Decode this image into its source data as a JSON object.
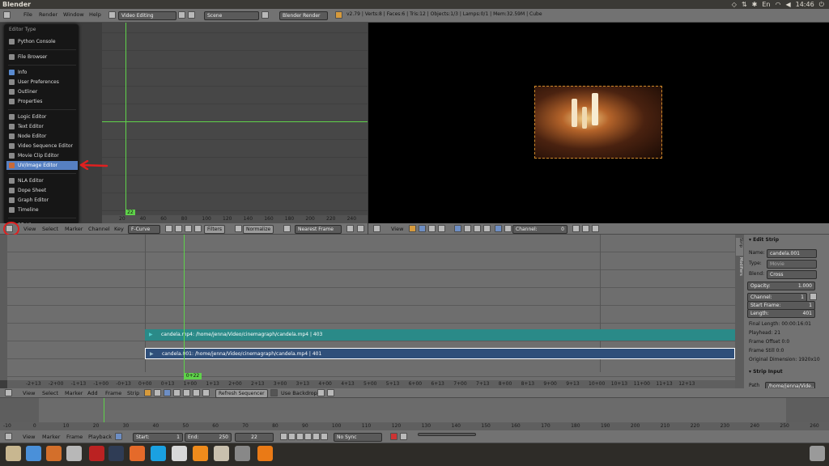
{
  "os": {
    "title": "Blender",
    "time": "14:46",
    "tray_icons": [
      "dropbox-icon",
      "transfer-icon",
      "bluetooth-icon",
      "keyboard-icon",
      "wifi-icon",
      "volume-icon",
      "power-icon"
    ]
  },
  "info_header": {
    "menus": [
      "File",
      "Render",
      "Window",
      "Help"
    ],
    "screen": "Video Editing",
    "scene": "Scene",
    "engine": "Blender Render",
    "stats": "v2.79 | Verts:8 | Faces:6 | Tris:12 | Objects:1/3 | Lamps:0/1 | Mem:32.59M | Cube"
  },
  "editor_menu": {
    "title": "Editor Type",
    "groups": [
      [
        {
          "label": "Python Console",
          "icon": "#8a8a8a"
        }
      ],
      [
        {
          "label": "File Browser",
          "icon": "#8a8a8a"
        }
      ],
      [
        {
          "label": "Info",
          "icon": "#5a8bd0"
        },
        {
          "label": "User Preferences",
          "icon": "#8a8a8a"
        },
        {
          "label": "Outliner",
          "icon": "#8a8a8a"
        },
        {
          "label": "Properties",
          "icon": "#8a8a8a"
        }
      ],
      [
        {
          "label": "Logic Editor",
          "icon": "#8a8a8a"
        },
        {
          "label": "Text Editor",
          "icon": "#8a8a8a"
        },
        {
          "label": "Node Editor",
          "icon": "#8a8a8a"
        },
        {
          "label": "Video Sequence Editor",
          "icon": "#8a8a8a"
        },
        {
          "label": "Movie Clip Editor",
          "icon": "#8a8a8a"
        },
        {
          "label": "UV/Image Editor",
          "icon": "#c96a3a",
          "selected": true
        }
      ],
      [
        {
          "label": "NLA Editor",
          "icon": "#8a8a8a"
        },
        {
          "label": "Dope Sheet",
          "icon": "#8a8a8a"
        },
        {
          "label": "Graph Editor",
          "icon": "#8a8a8a"
        },
        {
          "label": "Timeline",
          "icon": "#8a8a8a"
        }
      ],
      [
        {
          "label": "3D View",
          "icon": "#8a8a8a"
        }
      ]
    ]
  },
  "graph_editor": {
    "frame_badge": "22",
    "ruler": [
      "20",
      "40",
      "60",
      "80",
      "100",
      "120",
      "140",
      "160",
      "180",
      "200",
      "220",
      "240"
    ],
    "header": {
      "menus": [
        "View",
        "Select",
        "Marker",
        "Channel",
        "Key"
      ],
      "mode": "F-Curve",
      "filters": "Filters",
      "normalize": "Normalize",
      "snap": "Nearest Frame"
    }
  },
  "preview_header": {
    "menus": [
      "View"
    ],
    "channel": "Channel:",
    "channel_value": "0"
  },
  "sequencer": {
    "strips": [
      {
        "label": "candela.mp4: /home/jenna/Video/cinemagraph/candela.mp4 | 403",
        "color": "#2a8a88"
      },
      {
        "label": "candela.001: /home/jenna/Video/cinemagraph/candela.mp4 | 401",
        "color": "#2f4f7a"
      }
    ],
    "frame_badge": "0+22",
    "ruler": [
      "-2+13",
      "-2+00",
      "-1+13",
      "-1+00",
      "-0+13",
      "0+00",
      "0+13",
      "1+00",
      "1+13",
      "2+00",
      "2+13",
      "3+00",
      "3+13",
      "4+00",
      "4+13",
      "5+00",
      "5+13",
      "6+00",
      "6+13",
      "7+00",
      "7+13",
      "8+00",
      "8+13",
      "9+00",
      "9+13",
      "10+00",
      "10+13",
      "11+00",
      "11+13",
      "12+13"
    ],
    "header": {
      "menus": [
        "View",
        "Select",
        "Marker",
        "Add",
        "Frame",
        "Strip"
      ],
      "refresh": "Refresh Sequencer",
      "backdrop": "Use Backdrop"
    }
  },
  "sidebar": {
    "tabs": [
      "Strip",
      "Modifiers"
    ],
    "panel_title": "Edit Strip",
    "name_label": "Name:",
    "name_value": "candela.001",
    "type_label": "Type:",
    "type_value": "Movie",
    "blend_label": "Blend:",
    "blend_value": "Cross",
    "opacity_label": "Opacity:",
    "opacity_value": "1.000",
    "channel_label": "Channel:",
    "channel_value": "1",
    "start_label": "Start Frame:",
    "start_value": "1",
    "length_label": "Length:",
    "length_value": "401",
    "info": [
      "Final Length: 00:00:16:01",
      "Playhead: 21",
      "Frame Offset 0:0",
      "Frame Still 0:0",
      "Original Dimension: 1920x10"
    ],
    "input_title": "Strip Input",
    "path_label": "Path",
    "path_value": "/home/jenna/Vide..."
  },
  "timeline": {
    "ruler": [
      "-10",
      "0",
      "10",
      "20",
      "30",
      "40",
      "50",
      "60",
      "70",
      "80",
      "90",
      "100",
      "110",
      "120",
      "130",
      "140",
      "150",
      "160",
      "170",
      "180",
      "190",
      "200",
      "210",
      "220",
      "230",
      "240",
      "250",
      "260"
    ],
    "menus": [
      "View",
      "Marker",
      "Frame",
      "Playback"
    ],
    "start_label": "Start:",
    "start_value": "1",
    "end_label": "End:",
    "end_value": "250",
    "current": "22",
    "sync": "No Sync"
  },
  "colors": {
    "accent": "#5680c2",
    "playhead": "#5fd24a",
    "annotation": "#e02020"
  }
}
